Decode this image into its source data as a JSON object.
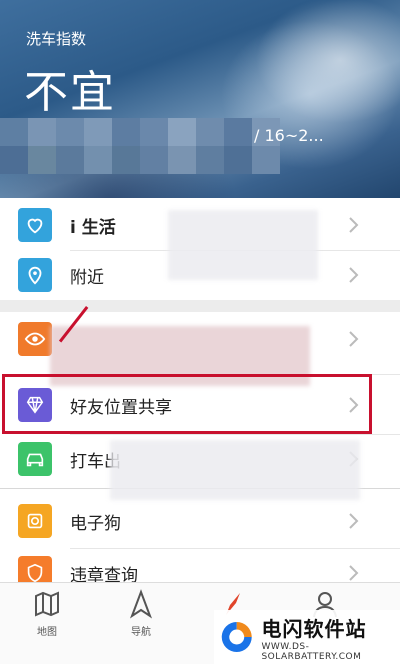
{
  "banner": {
    "label": "洗车指数",
    "value": "不宜",
    "temp_range": "/ 16~2..."
  },
  "menu": {
    "items": [
      {
        "label": "i 生活",
        "icon": "heart-icon",
        "color": "#33a3dc"
      },
      {
        "label": "附近",
        "icon": "location-pin-icon",
        "color": "#33a3dc"
      },
      {
        "label": "",
        "icon": "eye-icon",
        "color": "#f07a2b"
      },
      {
        "label": "好友位置共享",
        "icon": "diamond-icon",
        "color": "#6a5bd6"
      },
      {
        "label": "打车出",
        "icon": "car-icon",
        "color": "#3cc36a"
      },
      {
        "label": "电子狗",
        "icon": "camera-icon",
        "color": "#f5a623"
      },
      {
        "label": "违章查询",
        "icon": "shield-icon",
        "color": "#f57c2b"
      }
    ]
  },
  "tabbar": {
    "tabs": [
      {
        "label": "地图",
        "icon": "map-icon"
      },
      {
        "label": "导航",
        "icon": "navigation-arrow-icon"
      },
      {
        "label": "",
        "icon": "compass-icon"
      },
      {
        "label": "",
        "icon": "user-icon"
      }
    ]
  },
  "watermark": {
    "title": "电闪软件站",
    "url": "WWW.DS-SOLARBATTERY.COM"
  },
  "colors": {
    "highlight": "#c8102e",
    "banner": "#3a6795"
  }
}
